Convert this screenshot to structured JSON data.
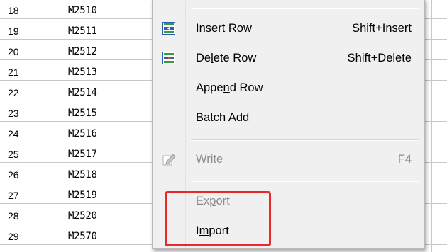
{
  "rows": [
    {
      "num": "18",
      "name": "M2510"
    },
    {
      "num": "19",
      "name": "M2511"
    },
    {
      "num": "20",
      "name": "M2512"
    },
    {
      "num": "21",
      "name": "M2513"
    },
    {
      "num": "22",
      "name": "M2514"
    },
    {
      "num": "23",
      "name": "M2515"
    },
    {
      "num": "24",
      "name": "M2516"
    },
    {
      "num": "25",
      "name": "M2517"
    },
    {
      "num": "26",
      "name": "M2518"
    },
    {
      "num": "27",
      "name": "M2519"
    },
    {
      "num": "28",
      "name": "M2520"
    },
    {
      "num": "29",
      "name": "M2570"
    }
  ],
  "menu": {
    "insert_row": {
      "pre": "",
      "key": "I",
      "post": "nsert Row",
      "shortcut": "Shift+Insert",
      "icon": "insert-row-icon"
    },
    "delete_row": {
      "pre": "De",
      "key": "l",
      "post": "ete Row",
      "shortcut": "Shift+Delete",
      "icon": "delete-row-icon"
    },
    "append_row": {
      "pre": "Appe",
      "key": "n",
      "post": "d Row"
    },
    "batch_add": {
      "pre": "",
      "key": "B",
      "post": "atch Add"
    },
    "write": {
      "pre": "",
      "key": "W",
      "post": "rite",
      "shortcut": "F4",
      "icon": "write-pencil-icon"
    },
    "export": {
      "pre": "Ex",
      "key": "p",
      "post": "ort"
    },
    "import": {
      "pre": "I",
      "key": "m",
      "post": "port"
    }
  },
  "colors": {
    "highlight_box": "#e8282a",
    "icon_green": "#3a9a3a",
    "icon_blue": "#2a5fb0",
    "disabled_text": "#8c8c8c"
  }
}
